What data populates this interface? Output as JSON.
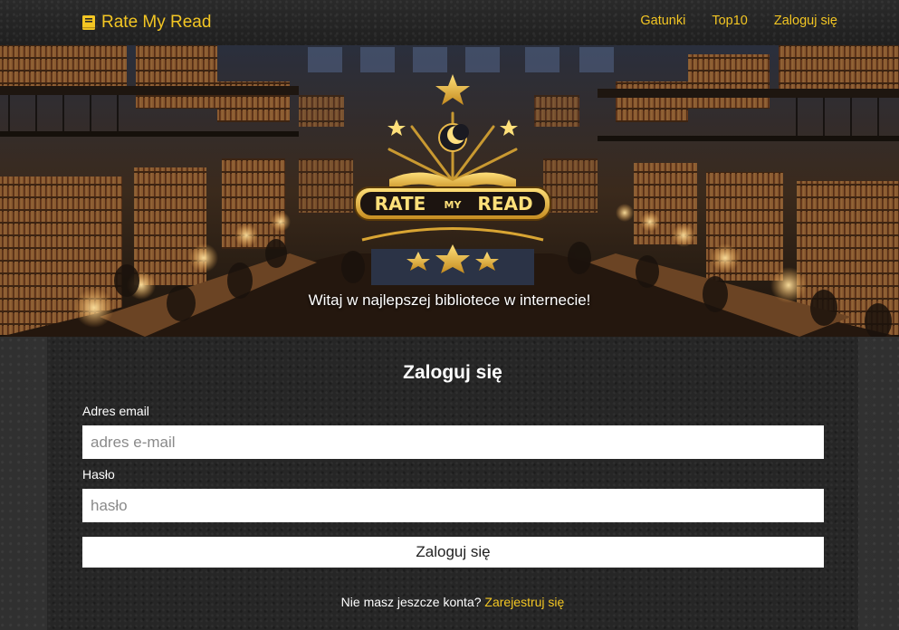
{
  "navbar": {
    "brand": "Rate My Read",
    "brand_icon": "book-icon",
    "links": [
      {
        "label": "Gatunki"
      },
      {
        "label": "Top10"
      },
      {
        "label": "Zaloguj się"
      }
    ],
    "accent_color": "#f3c623"
  },
  "hero": {
    "caption": "Witaj w najlepszej bibliotece w internecie!",
    "logo_text_left": "RATE",
    "logo_text_middle": "MY",
    "logo_text_right": "READ"
  },
  "login_form": {
    "title": "Zaloguj się",
    "email_label": "Adres email",
    "email_placeholder": "adres e-mail",
    "email_value": "",
    "password_label": "Hasło",
    "password_placeholder": "hasło",
    "password_value": "",
    "submit_label": "Zaloguj się",
    "register_prompt": "Nie masz jeszcze konta?",
    "register_link": "Zarejestruj się"
  }
}
